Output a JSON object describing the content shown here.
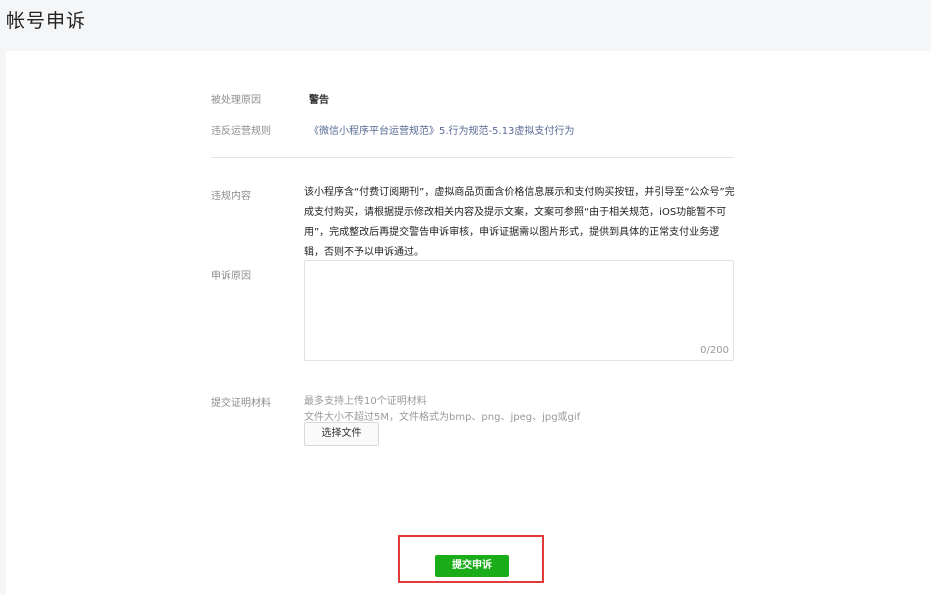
{
  "page": {
    "title": "帐号申诉"
  },
  "info": {
    "reason_label": "被处理原因",
    "reason_value": "警告",
    "rule_label": "违反运营规则",
    "rule_link": "《微信小程序平台运营规范》5.行为规范-5.13虚拟支付行为"
  },
  "violation": {
    "label": "违规内容",
    "text": "该小程序含“付费订阅期刊”，虚拟商品页面含价格信息展示和支付购买按钮，并引导至“公众号”完成支付购买，请根据提示修改相关内容及提示文案，文案可参照“由于相关规范，iOS功能暂不可用”，完成整改后再提交警告申诉审核，申诉证据需以图片形式，提供到具体的正常支付业务逻辑，否则不予以申诉通过。"
  },
  "appeal": {
    "label": "申诉原因",
    "counter": "0/200"
  },
  "evidence": {
    "label": "提交证明材料",
    "hint1": "最多支持上传10个证明材料",
    "hint2": "文件大小不超过5M，文件格式为bmp、png、jpeg、jpg或gif",
    "file_button": "选择文件"
  },
  "submit": {
    "label": "提交申诉"
  },
  "colors": {
    "accent": "#1aad19",
    "link": "#576b95",
    "highlight": "#e03a3a"
  }
}
